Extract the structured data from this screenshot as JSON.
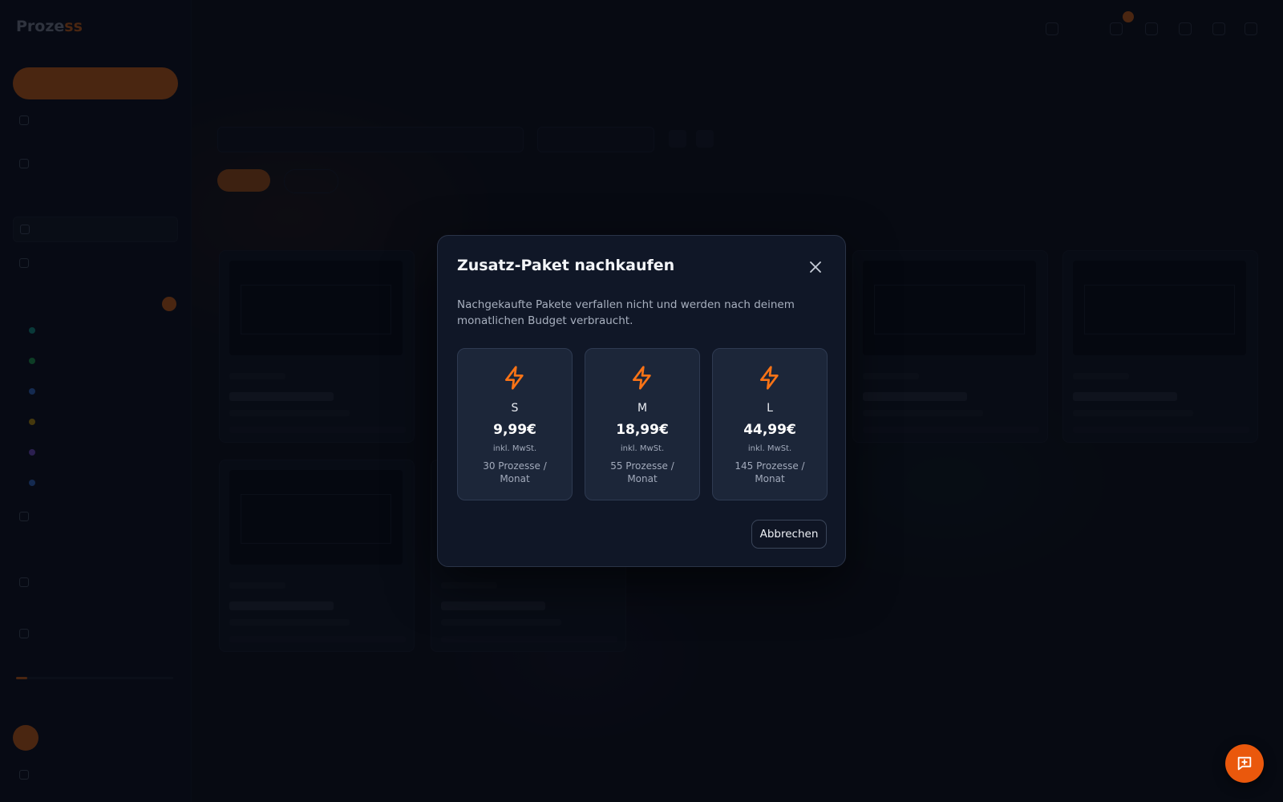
{
  "modal": {
    "title": "Zusatz-Paket nachkaufen",
    "description": "Nachgekaufte Pakete verfallen nicht und werden nach deinem monatlichen Budget verbraucht.",
    "packages": [
      {
        "size": "S",
        "price": "9,99€",
        "vat": "inkl. MwSt.",
        "count": "30 Prozesse / Monat",
        "icon": "lightning-icon"
      },
      {
        "size": "M",
        "price": "18,99€",
        "vat": "inkl. MwSt.",
        "count": "55 Prozesse / Monat",
        "icon": "lightning-icon"
      },
      {
        "size": "L",
        "price": "44,99€",
        "vat": "inkl. MwSt.",
        "count": "145 Prozesse / Monat",
        "icon": "lightning-icon"
      }
    ],
    "cancel_label": "Abbrechen",
    "close_icon": "close-icon"
  },
  "colors": {
    "accent": "#f97316",
    "modal_bg": "#101727",
    "package_bg": "#1c2639",
    "overlay": "rgba(5,8,15,0.72)"
  },
  "fab": {
    "icon": "chat-plus-icon"
  }
}
